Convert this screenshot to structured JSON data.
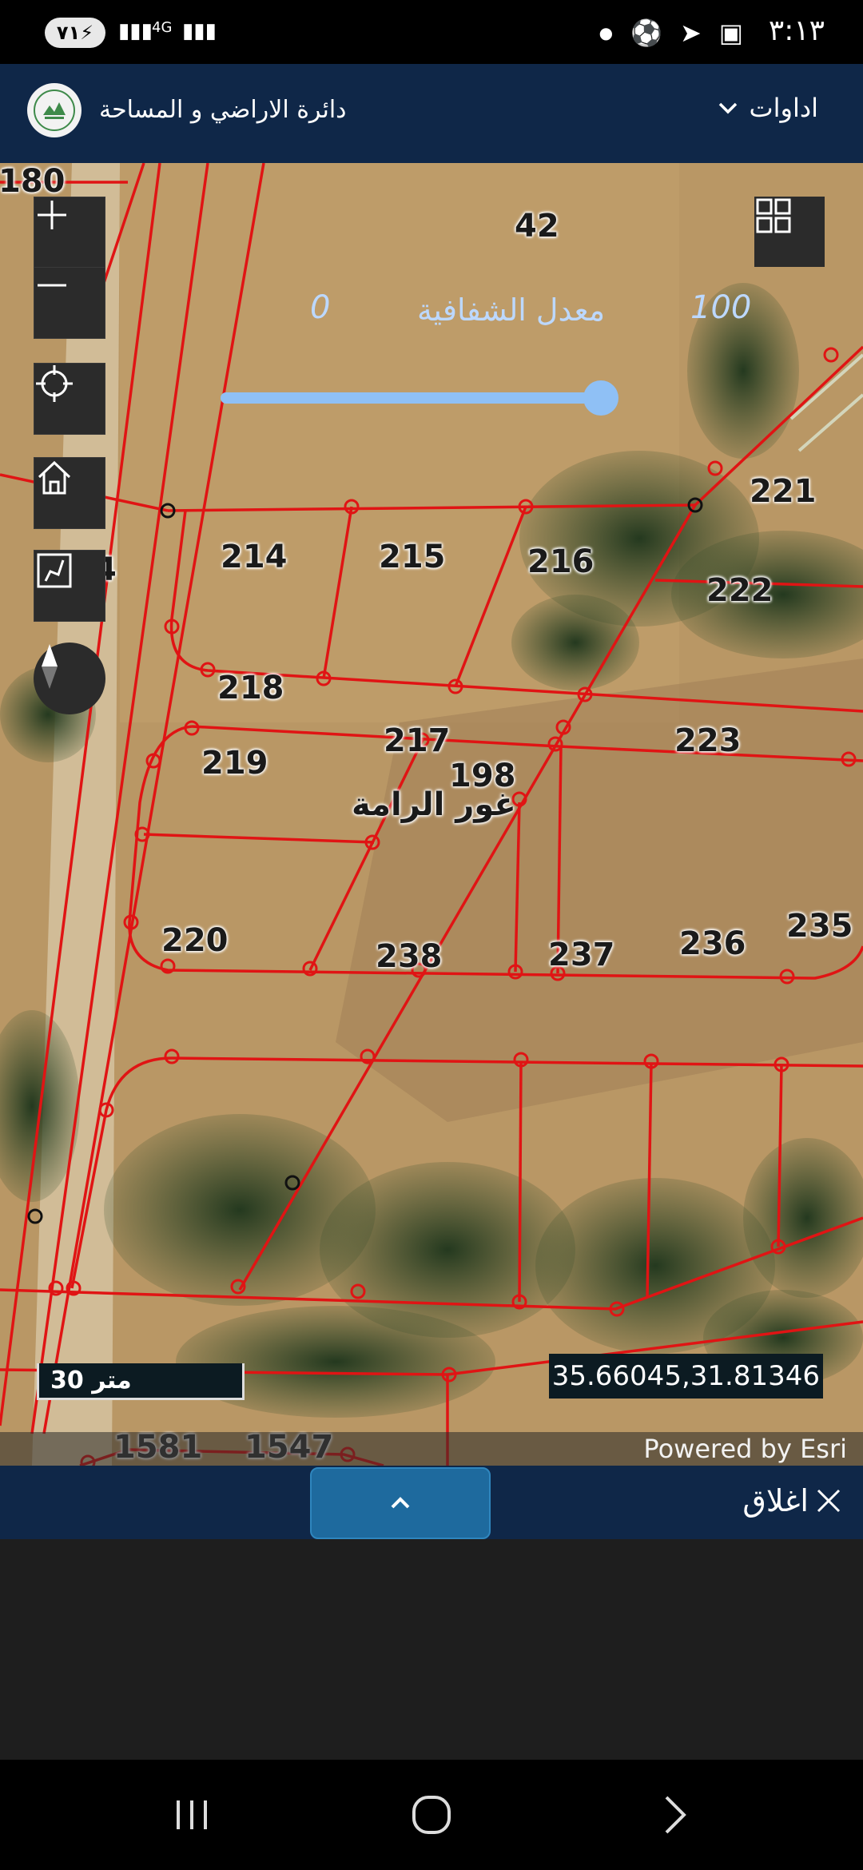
{
  "status_bar": {
    "battery": "٧١",
    "network": "4G",
    "time": "٣:١٣"
  },
  "header": {
    "title": "دائرة الاراضي و المساحة",
    "tools_label": "اداوات"
  },
  "map": {
    "opacity": {
      "label": "معدل الشفافية",
      "min": "0",
      "max": "100",
      "value": 1.0
    },
    "parcels": [
      "180",
      "42",
      "221",
      "214",
      "215",
      "216",
      "222",
      "218",
      "217",
      "219",
      "198",
      "223",
      "220",
      "238",
      "237",
      "236",
      "235",
      "1581",
      "1547"
    ],
    "area_name": "غور الرامة",
    "partial_label": "4",
    "scale": "30 متر",
    "coordinates": "35.66045,31.81346",
    "attribution": "Powered by Esri"
  },
  "bottom": {
    "close_label": "اغلاق"
  },
  "colors": {
    "header_bg": "#0f2748",
    "parcel_line": "#e01414",
    "slider": "#8fc0f5"
  }
}
